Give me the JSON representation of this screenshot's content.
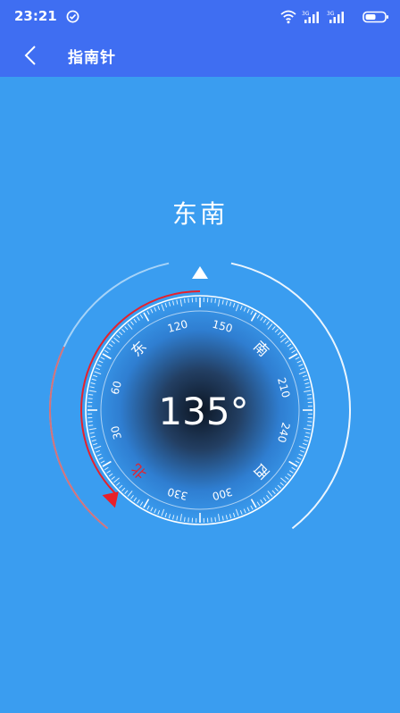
{
  "status_bar": {
    "time": "23:21",
    "icons": [
      "check-circle-icon",
      "wifi-icon",
      "signal-3g-icon",
      "signal-3g-icon",
      "battery-icon"
    ],
    "network_label_1": "3G",
    "network_label_2": "3G"
  },
  "app_bar": {
    "title": "指南针",
    "back_icon": "chevron-left-icon"
  },
  "compass": {
    "direction_text": "东南",
    "heading_text": "135°",
    "heading_degrees": 135,
    "labels": [
      {
        "text": "120",
        "kind": "num"
      },
      {
        "text": "150",
        "kind": "num"
      },
      {
        "text": "南",
        "kind": "dir"
      },
      {
        "text": "210",
        "kind": "num"
      },
      {
        "text": "240",
        "kind": "num"
      },
      {
        "text": "西",
        "kind": "dir"
      },
      {
        "text": "300",
        "kind": "num"
      },
      {
        "text": "330",
        "kind": "num"
      },
      {
        "text": "北",
        "kind": "north"
      },
      {
        "text": "30",
        "kind": "num"
      },
      {
        "text": "60",
        "kind": "num"
      },
      {
        "text": "东",
        "kind": "dir"
      }
    ],
    "colors": {
      "background": "#3a9df0",
      "bar": "#3f6ef2",
      "accent_red": "#e8202a",
      "ring": "#ffffff"
    }
  }
}
